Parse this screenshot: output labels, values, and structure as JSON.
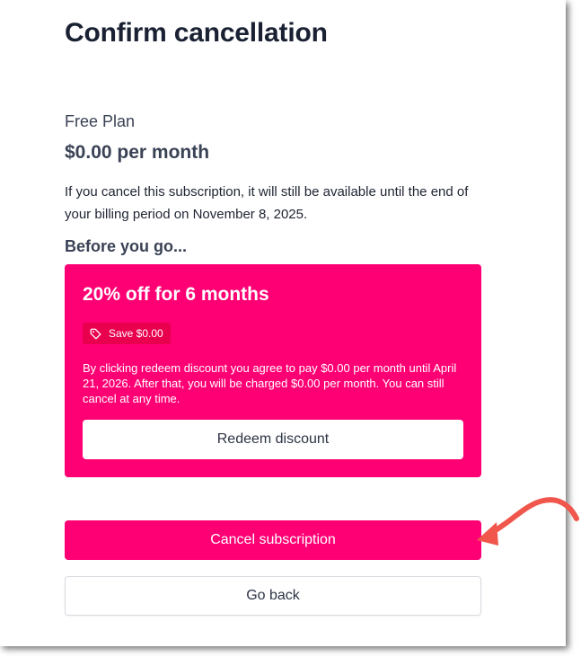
{
  "page_title": "Confirm cancellation",
  "plan": {
    "name": "Free Plan",
    "price": "$0.00 per month"
  },
  "cancel_info": "If you cancel this subscription, it will still be available until the end of your billing period on November 8, 2025.",
  "before_heading": "Before you go...",
  "offer": {
    "title": "20% off for 6 months",
    "badge": "Save $0.00",
    "terms": "By clicking redeem discount you agree to pay $0.00 per month until April 21, 2026. After that, you will be charged $0.00 per month. You can still cancel at any time.",
    "redeem_label": "Redeem discount"
  },
  "cancel_label": "Cancel subscription",
  "back_label": "Go back",
  "icons": {
    "badge_icon": "tag-icon",
    "annotation": "annotation-arrow-icon"
  },
  "colors": {
    "brand": "#ff0074",
    "badge_bg": "#e8004f",
    "heading_text": "#1a2133",
    "arrow": "#f0564c"
  }
}
